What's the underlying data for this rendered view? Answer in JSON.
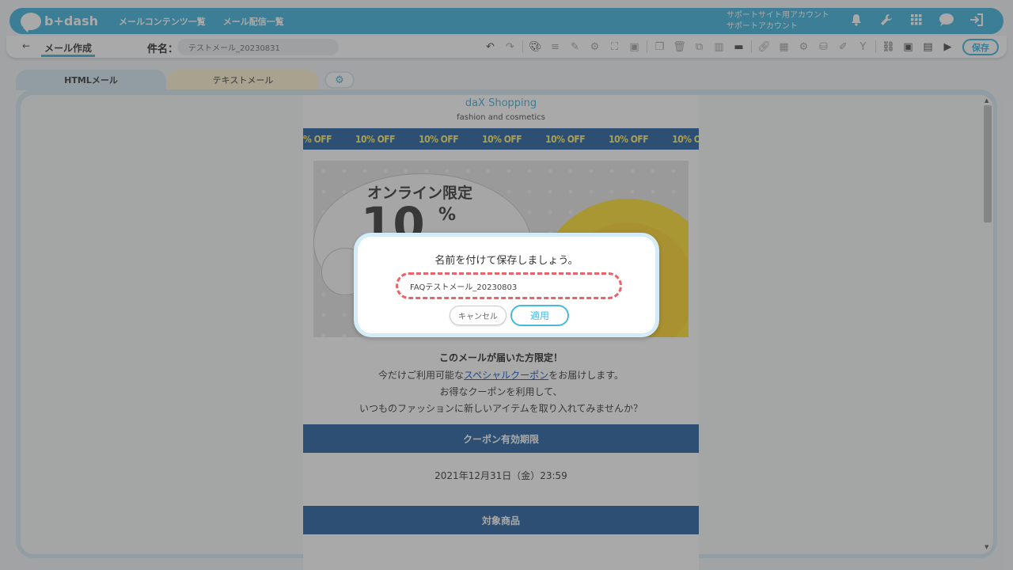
{
  "app": {
    "logo_text": "b+dash"
  },
  "topnav": {
    "items": [
      "メールコンテンツ一覧",
      "メール配信一覧"
    ]
  },
  "account": {
    "line1": "サポートサイト用アカウント",
    "line2": "サポートアカウント"
  },
  "top_icons": [
    "bell-icon",
    "wrench-icon",
    "apps-grid-icon",
    "chat-icon",
    "logout-icon"
  ],
  "subbar": {
    "back_label": "←",
    "page_title": "メール作成",
    "subject_label": "件名：",
    "subject_value": "テストメール_20230831",
    "save_label": "保存"
  },
  "tabs": {
    "html": "HTMLメール",
    "text": "テキストメール"
  },
  "email": {
    "shop_name": "daX Shopping",
    "shop_tagline": "fashion and cosmetics",
    "ticker_text": "10% OFF",
    "hero_online": "オンライン限定",
    "hero_big": "10",
    "hero_pct": "%",
    "lead": "このメールが届いた方限定！",
    "body_line1_pre": "今だけご利用可能な",
    "body_line1_link": "スペシャルクーポン",
    "body_line1_post": "をお届けします。",
    "body_line2": "お得なクーポンを利用して、",
    "body_line3": "いつものファッションに新しいアイテムを取り入れてみませんか？",
    "section1": "クーポン有効期限",
    "expiry": "2021年12月31日（金）23:59",
    "section2": "対象商品"
  },
  "dialog": {
    "title": "名前を付けて保存しましょう。",
    "name_value": "FAQテストメール_20230803",
    "cancel_label": "キャンセル",
    "apply_label": "適用"
  },
  "colors": {
    "accent": "#48b8e0",
    "highlight_dash": "#e8646a",
    "email_bar": "#2f6aa6"
  }
}
